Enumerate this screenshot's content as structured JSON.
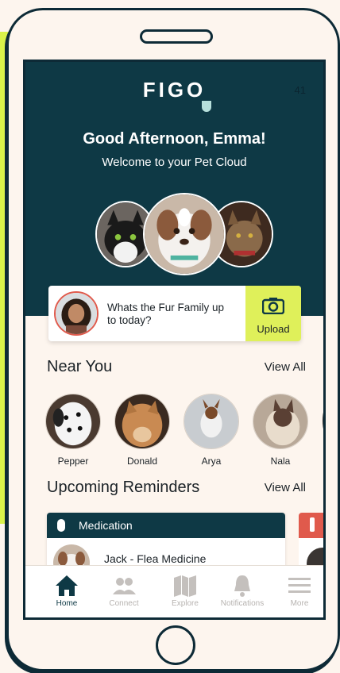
{
  "app": {
    "logo": "FIGO",
    "status_time": "41"
  },
  "hero": {
    "greeting": "Good Afternoon, Emma!",
    "subtitle": "Welcome to your Pet Cloud"
  },
  "upload": {
    "prompt": "Whats the Fur Family up to today?",
    "button_label": "Upload"
  },
  "near_you": {
    "title": "Near You",
    "view_all": "View All",
    "pets": [
      {
        "name": "Pepper"
      },
      {
        "name": "Donald"
      },
      {
        "name": "Arya"
      },
      {
        "name": "Nala"
      }
    ]
  },
  "reminders": {
    "title": "Upcoming Reminders",
    "view_all": "View All",
    "items": [
      {
        "category": "Medication",
        "title": "Jack - Flea Medicine"
      }
    ]
  },
  "tabs": [
    {
      "label": "Home",
      "icon": "home-icon",
      "active": true
    },
    {
      "label": "Connect",
      "icon": "people-icon",
      "active": false
    },
    {
      "label": "Explore",
      "icon": "map-icon",
      "active": false
    },
    {
      "label": "Notifications",
      "icon": "bell-icon",
      "active": false
    },
    {
      "label": "More",
      "icon": "menu-icon",
      "active": false
    }
  ],
  "colors": {
    "primary": "#0e3945",
    "accent": "#dff05a",
    "alert": "#e05a4c",
    "background": "#fdf5ee"
  }
}
